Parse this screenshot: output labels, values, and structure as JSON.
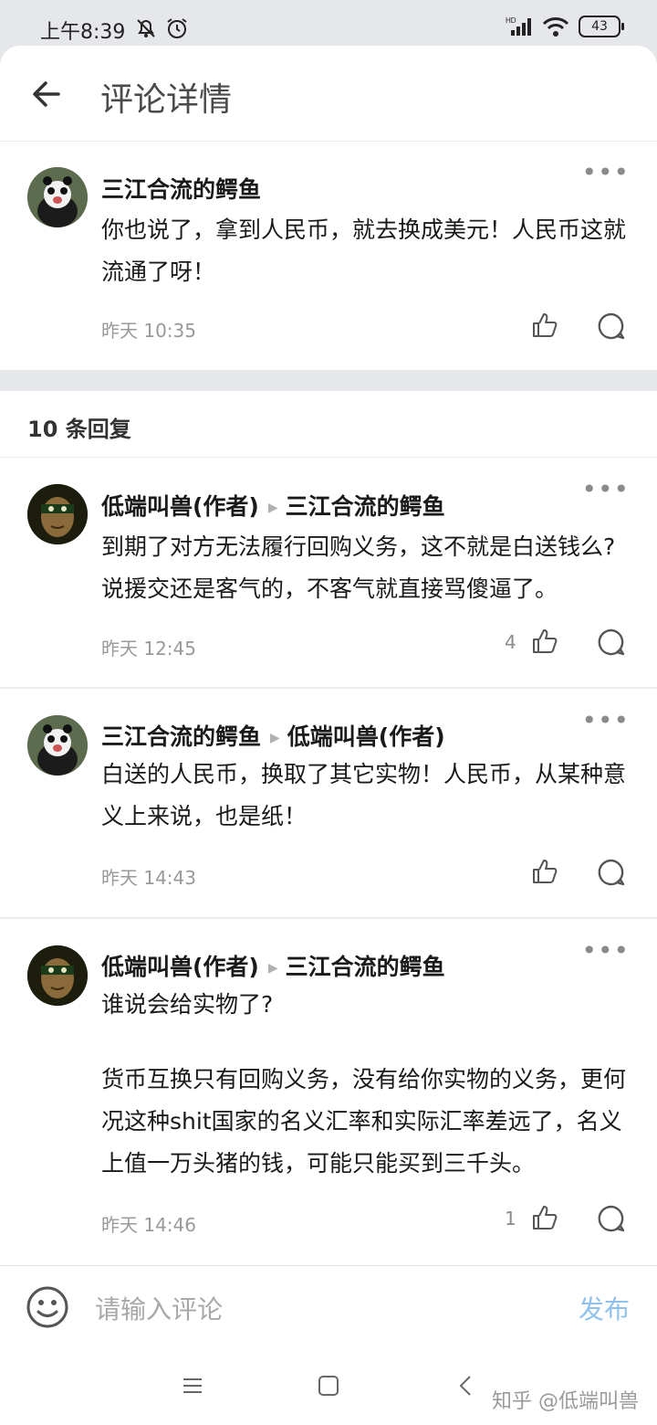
{
  "status": {
    "time": "上午8:39",
    "battery": "43"
  },
  "header": {
    "title": "评论详情"
  },
  "main_comment": {
    "author": "三江合流的鳄鱼",
    "text": "你也说了，拿到人民币，就去换成美元！人民币这就流通了呀！",
    "time": "昨天 10:35",
    "likes": ""
  },
  "replies_title": "10 条回复",
  "replies": [
    {
      "author": "低端叫兽(作者)",
      "to": "三江合流的鳄鱼",
      "text": "到期了对方无法履行回购义务，这不就是白送钱么?说援交还是客气的，不客气就直接骂傻逼了。",
      "time": "昨天 12:45",
      "likes": "4"
    },
    {
      "author": "三江合流的鳄鱼",
      "to": "低端叫兽(作者)",
      "text": "白送的人民币，换取了其它实物！人民币，从某种意义上来说，也是纸！",
      "time": "昨天 14:43",
      "likes": ""
    },
    {
      "author": "低端叫兽(作者)",
      "to": "三江合流的鳄鱼",
      "text_line1": "谁说会给实物了?",
      "text_line2": "货币互换只有回购义务，没有给你实物的义务，更何况这种shit国家的名义汇率和实际汇率差远了，名义上值一万头猪的钱，可能只能买到三千头。",
      "time": "昨天 14:46",
      "likes": "1"
    }
  ],
  "input": {
    "placeholder": "请输入评论",
    "publish": "发布"
  },
  "watermark": "知乎 @低端叫兽",
  "colors": {
    "publish": "#8fc1ee",
    "muted": "#999999"
  }
}
